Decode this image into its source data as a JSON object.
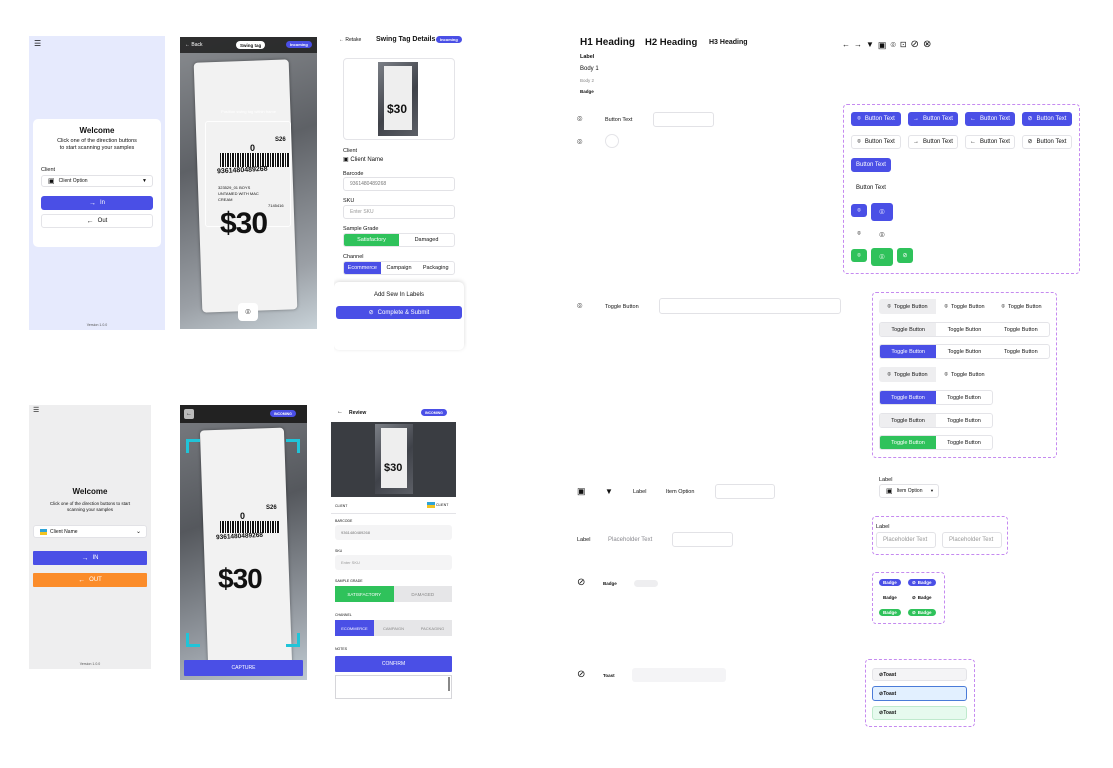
{
  "screen1": {
    "title": "Welcome",
    "subtitle": "Click one of the direction buttons to start scanning your samples",
    "client_label": "Client",
    "client_option": "Client Option",
    "in_label": "In",
    "out_label": "Out",
    "version": "Version 1.0.0"
  },
  "screen2": {
    "back_label": "Back",
    "title": "Swing tag",
    "badge": "Incoming",
    "hint": "Position swing tag within frame",
    "tag_code": "S26",
    "tag_size": "0",
    "barcode": "9361480489268",
    "tag_line1": "323529_01 BOYS",
    "tag_line2": "UNTAMED WITH MAC",
    "tag_line3": "CREAM",
    "tag_num": "7145416",
    "price": "$30"
  },
  "screen3": {
    "retake_label": "Retake",
    "title": "Swing Tag Details",
    "badge": "Incoming",
    "client_label": "Client",
    "client_name": "Client Name",
    "barcode_label": "Barcode",
    "barcode_value": "9361480489268",
    "sku_label": "SKU",
    "sku_placeholder": "Enter SKU",
    "grade_label": "Sample Grade",
    "grade_options": [
      "Satisfactory",
      "Damaged"
    ],
    "channel_label": "Channel",
    "channel_options": [
      "Ecommerce",
      "Campaign",
      "Packaging"
    ],
    "sew_in_label": "Add Sew In Labels",
    "submit_label": "Complete & Submit"
  },
  "screen4": {
    "title": "Welcome",
    "subtitle": "Click one of the direction buttons to start scanning your samples",
    "client_name": "Client Name",
    "in_label": "IN",
    "out_label": "OUT",
    "version": "Version 1.0.0"
  },
  "screen5": {
    "badge": "INCOMING",
    "capture_label": "CAPTURE"
  },
  "screen6": {
    "title": "Review",
    "badge": "INCOMING",
    "client_label": "CLIENT",
    "client_value": "CLIENT",
    "barcode_label": "BARCODE",
    "barcode_value": "9361480489268",
    "sku_label": "SKU",
    "sku_placeholder": "Enter SKU",
    "grade_label": "SAMPLE GRADE",
    "grade_options": [
      "SATISFACTORY",
      "DAMAGED"
    ],
    "channel_label": "CHANNEL",
    "channel_options": [
      "ECOMMERCE",
      "CAMPAIGN",
      "PACKAGING"
    ],
    "notes_label": "NOTES",
    "confirm_label": "CONFIRM"
  },
  "styleguide": {
    "h1": "H1 Heading",
    "h2": "H2 Heading",
    "h3": "H3 Heading",
    "label": "Label",
    "body1": "Body 1",
    "body2": "Body 2",
    "badge": "Badge",
    "button_text_label": "Button Text",
    "toggle_button_label": "Toggle Button",
    "dropdown_label": "Label",
    "dropdown_item": "Item Option",
    "input_label": "Label",
    "placeholder": "Placeholder Text",
    "badge_row_label": "Badge",
    "toast_row_label": "Toast"
  },
  "buttons": {
    "button_text": "Button Text"
  },
  "toggles": {
    "toggle_text": "Toggle Button"
  },
  "dropdown_demo": {
    "label": "Label",
    "item": "Item Option"
  },
  "input_demo": {
    "label": "Label",
    "placeholder": "Placeholder Text"
  },
  "badges": {
    "text": "Badge"
  },
  "toasts": {
    "text": "Toast"
  },
  "colors": {
    "primary": "#4a4fe6",
    "success": "#2fc25b",
    "warning": "#fb8c2a",
    "screen_bg": "#e6eafd",
    "guide_dashed": "#c58af0"
  }
}
